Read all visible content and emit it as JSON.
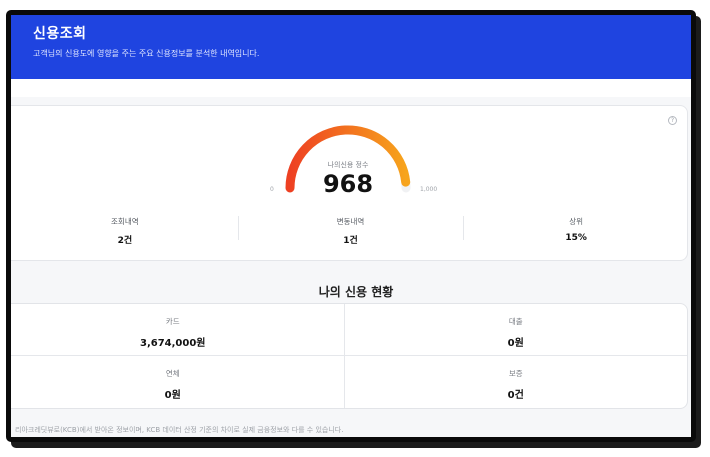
{
  "header": {
    "title": "신용조회",
    "subtitle": "고객님의 신용도에 영향을 주는 주요 신용정보를 분석한 내역입니다."
  },
  "score": {
    "label": "나의신용 정수",
    "value": "968",
    "score_number": 968,
    "min_label": "0",
    "max_label": "1,000",
    "gauge_colors": [
      "#ee4022",
      "#f7a41c"
    ]
  },
  "stats": [
    {
      "label": "조회내역",
      "value": "2건"
    },
    {
      "label": "변동내역",
      "value": "1건"
    },
    {
      "label": "상위",
      "value": "15%"
    }
  ],
  "status": {
    "title": "나의 신용 현황",
    "items": [
      {
        "label": "카드",
        "value": "3,674,000원"
      },
      {
        "label": "대출",
        "value": "0원"
      },
      {
        "label": "연체",
        "value": "0원"
      },
      {
        "label": "보증",
        "value": "0건"
      }
    ]
  },
  "footnote": "리아크레딧뷰로(KCB)에서 받아온 정보이며, KCB 데이터 산정 기준의 차이로 실제 금융정보와 다를 수 있습니다.",
  "colors": {
    "header_bg": "#1f44e0",
    "accent_red": "#ee4022",
    "accent_orange": "#f7a41c"
  }
}
